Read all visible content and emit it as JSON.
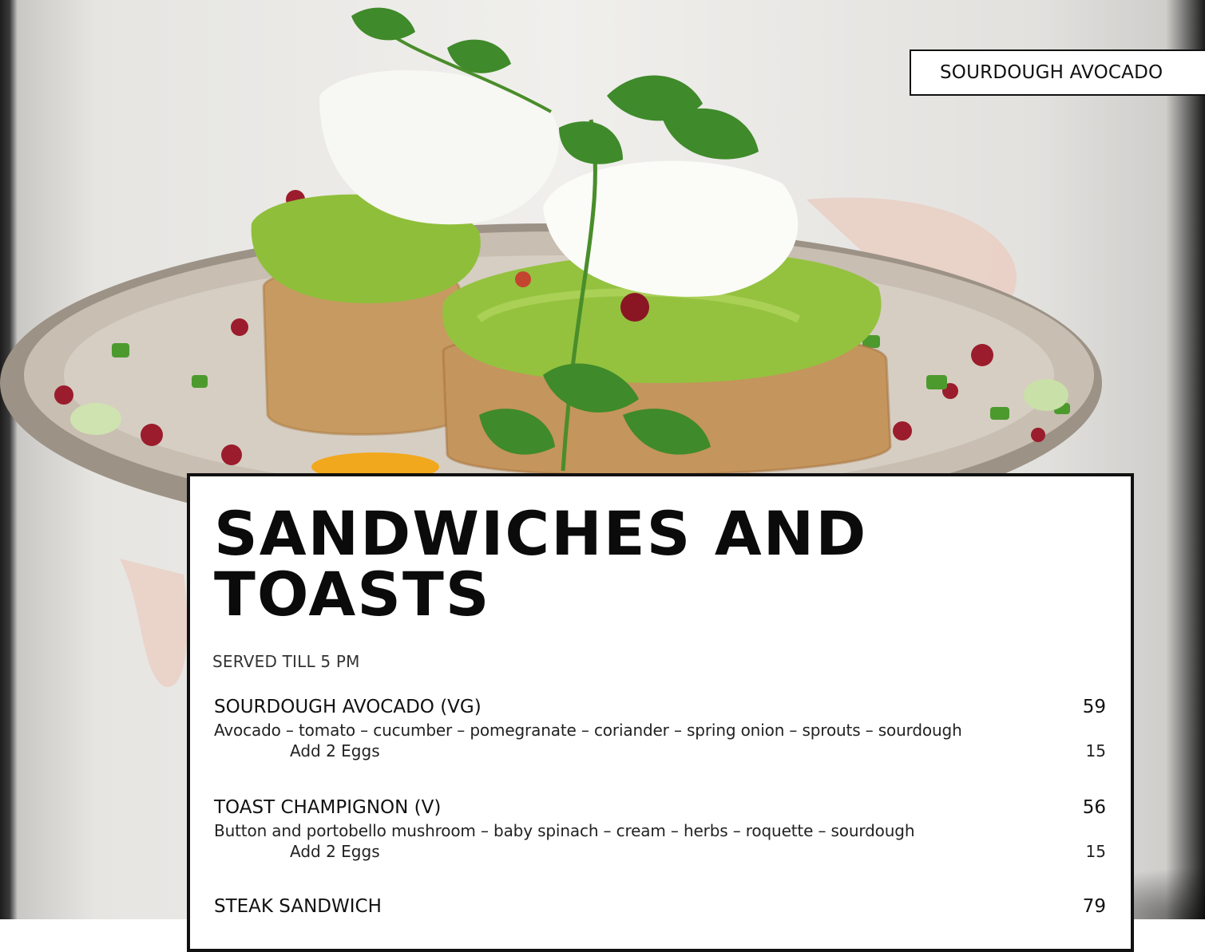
{
  "corner_tag": "SOURDOUGH AVOCADO",
  "menu": {
    "title_line1": "SANDWICHES AND",
    "title_line2": "TOASTS",
    "subtitle": "SERVED TILL 5 PM",
    "items": [
      {
        "name": "SOURDOUGH AVOCADO (VG)",
        "price": "59",
        "description": "Avocado – tomato – cucumber – pomegranate – coriander – spring onion – sprouts – sourdough",
        "addon": {
          "name": "Add 2 Eggs",
          "price": "15"
        }
      },
      {
        "name": "TOAST CHAMPIGNON (V)",
        "price": "56",
        "description": "Button and portobello mushroom – baby spinach – cream – herbs – roquette – sourdough",
        "addon": {
          "name": "Add 2 Eggs",
          "price": "15"
        }
      },
      {
        "name": "STEAK SANDWICH",
        "price": "79"
      }
    ]
  },
  "colors": {
    "avocado": "#8fbf3a",
    "bread": "#c99b66",
    "plate": "#bdb3a5",
    "pomegranate": "#9b1c2c",
    "herb": "#3f8a2a"
  }
}
